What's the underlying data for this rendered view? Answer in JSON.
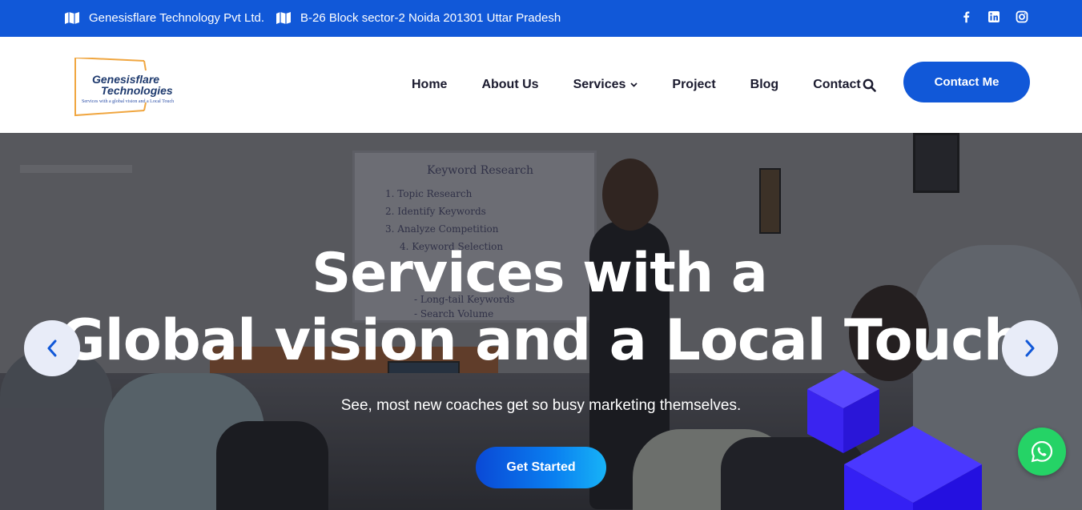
{
  "topbar": {
    "company": "Genesisflare Technology Pvt Ltd.",
    "address": "B-26 Block sector-2 Noida 201301 Uttar Pradesh",
    "social": [
      "facebook-icon",
      "linkedin-icon",
      "instagram-icon"
    ]
  },
  "header": {
    "logo": {
      "line1": "Genesisflare",
      "line2": "Technologies",
      "tagline": "Services with a global vision and a Local Touch"
    },
    "nav": [
      "Home",
      "About Us",
      "Services",
      "Project",
      "Blog",
      "Contact"
    ],
    "contact_button": "Contact Me"
  },
  "hero": {
    "title_line1": "Services with a",
    "title_line2": "Global vision and a Local Touch",
    "subtitle": "See, most new coaches get so busy marketing themselves.",
    "cta": "Get Started",
    "board": {
      "heading": "Keyword Research",
      "items": [
        "1. Topic Research",
        "2. Identify Keywords",
        "3. Analyze Competition",
        "4. Keyword Selection",
        "- Long-tail Keywords",
        "- Search Volume"
      ]
    }
  },
  "colors": {
    "brand_blue": "#1158d8",
    "whatsapp_green": "#25d366",
    "cube_blue": "#3b2bff"
  }
}
